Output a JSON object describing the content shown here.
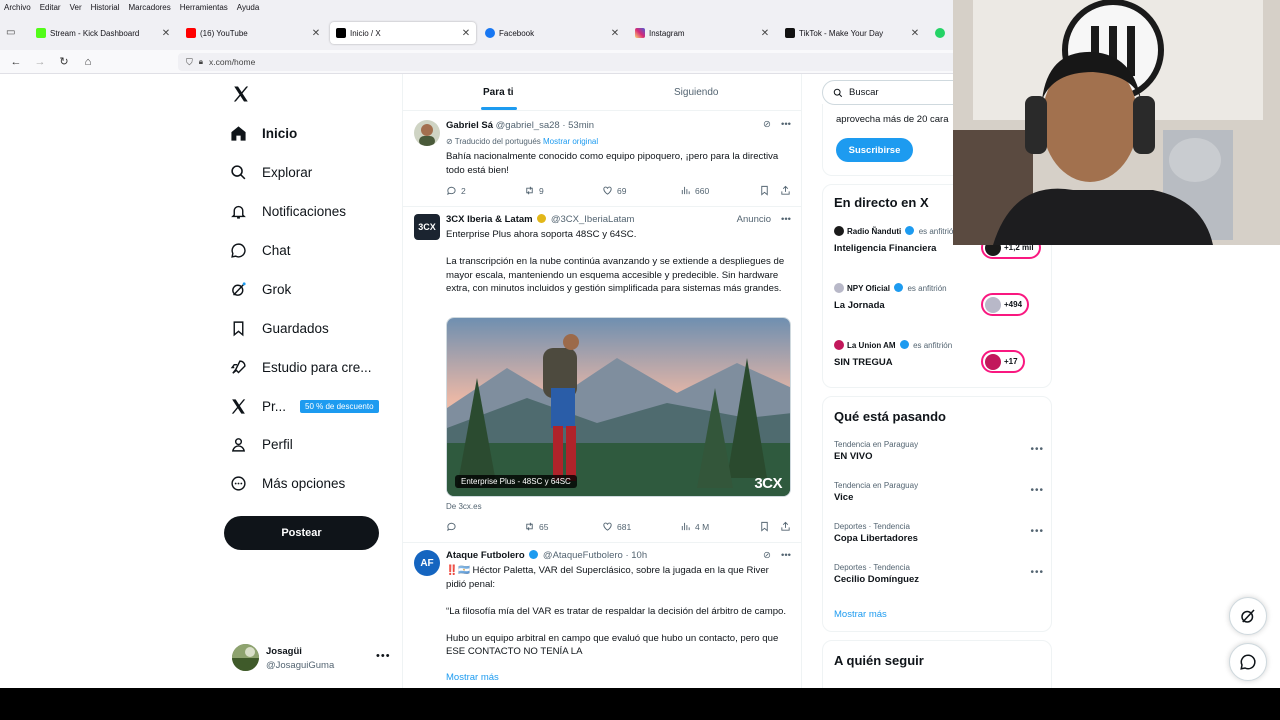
{
  "browser": {
    "menu": [
      "Archivo",
      "Editar",
      "Ver",
      "Historial",
      "Marcadores",
      "Herramientas",
      "Ayuda"
    ],
    "tabs": [
      {
        "label": "Stream - Kick Dashboard",
        "color": "#53fc18",
        "active": false
      },
      {
        "label": "(16) YouTube",
        "color": "#ff0000",
        "active": false
      },
      {
        "label": "Inicio / X",
        "color": "#000000",
        "active": true
      },
      {
        "label": "Facebook",
        "color": "#1877f2",
        "active": false
      },
      {
        "label": "Instagram",
        "color": "#d62976",
        "active": false
      },
      {
        "label": "TikTok - Make Your Day",
        "color": "#111111",
        "active": false
      }
    ],
    "url": "x.com/home"
  },
  "nav": {
    "items": [
      {
        "label": "Inicio",
        "icon": "home-icon"
      },
      {
        "label": "Explorar",
        "icon": "search-icon"
      },
      {
        "label": "Notificaciones",
        "icon": "bell-icon"
      },
      {
        "label": "Chat",
        "icon": "chat-icon"
      },
      {
        "label": "Grok",
        "icon": "grok-icon"
      },
      {
        "label": "Guardados",
        "icon": "bookmark-icon"
      },
      {
        "label": "Estudio para cre...",
        "icon": "rocket-icon"
      },
      {
        "label": "Pr...",
        "icon": "x-logo-icon"
      },
      {
        "label": "Perfil",
        "icon": "person-icon"
      },
      {
        "label": "Más opciones",
        "icon": "more-circle-icon"
      }
    ],
    "premium_badge": "50 % de descuento",
    "post_button": "Postear",
    "profile": {
      "name": "Josagüi",
      "handle": "@JosaguiGuma"
    }
  },
  "feed": {
    "tabs": [
      "Para ti",
      "Siguiendo"
    ],
    "tweets": [
      {
        "name": "Gabriel Sá",
        "handle": "@gabriel_sa28",
        "time": "53min",
        "translated_label": "Traducido del portugués",
        "translated_link": "Mostrar original",
        "text": "Bahía nacionalmente conocido como equipo pipoquero, ¡pero para la directiva todo está bien!",
        "replies": "2",
        "retweets": "9",
        "likes": "69",
        "views": "660"
      },
      {
        "name": "3CX Iberia & Latam",
        "handle": "@3CX_IberiaLatam",
        "ad_label": "Anuncio",
        "text": "Enterprise Plus ahora soporta 48SC y 64SC.\n\nLa transcripción en la nube continúa avanzando y se extiende a despliegues de mayor escala, manteniendo un esquema accesible y predecible. Sin hardware extra, con minutos incluidos y gestión simplificada para sistemas más grandes.",
        "media_caption": "Enterprise Plus - 48SC y 64SC",
        "media_logo": "3CX",
        "source": "De 3cx.es",
        "replies": "",
        "retweets": "65",
        "likes": "681",
        "views": "4 M"
      },
      {
        "name": "Ataque Futbolero",
        "handle": "@AtaqueFutbolero",
        "time": "10h",
        "text": "‼️🇦🇷 Héctor Paletta, VAR del Superclásico, sobre la jugada en la que River pidió penal:\n\n“La filosofía mía del VAR es tratar de respaldar la decisión del árbitro de campo.\n\nHubo un equipo arbitral en campo que evaluó que hubo un contacto, pero que ESE CONTACTO NO TENÍA LA",
        "show_more": "Mostrar más"
      }
    ]
  },
  "sidebar": {
    "search_placeholder": "Buscar",
    "premium_snippet": "aprovecha más de 20 cara",
    "subscribe": "Suscribirse",
    "live": {
      "title": "En directo en X",
      "host_suffix": "es anfitrión",
      "spaces": [
        {
          "host": "Radio Ñanduti",
          "title": "Inteligencia Financiera",
          "count": "+1,2 mil",
          "color": "#1a1a1a"
        },
        {
          "host": "NPY Oficial",
          "title": "La Jornada",
          "count": "+494",
          "color": "#b8b8c8"
        },
        {
          "host": "La Union AM",
          "title": "SIN TREGUA",
          "count": "+17",
          "color": "#c2185b"
        }
      ]
    },
    "trends": {
      "title": "Qué está pasando",
      "items": [
        {
          "context": "Tendencia en Paraguay",
          "name": "EN VIVO"
        },
        {
          "context": "Tendencia en Paraguay",
          "name": "Vice"
        },
        {
          "context": "Deportes · Tendencia",
          "name": "Copa Libertadores"
        },
        {
          "context": "Deportes · Tendencia",
          "name": "Cecilio Domínguez"
        }
      ],
      "show_more": "Mostrar más"
    },
    "follow_title": "A quién seguir"
  }
}
